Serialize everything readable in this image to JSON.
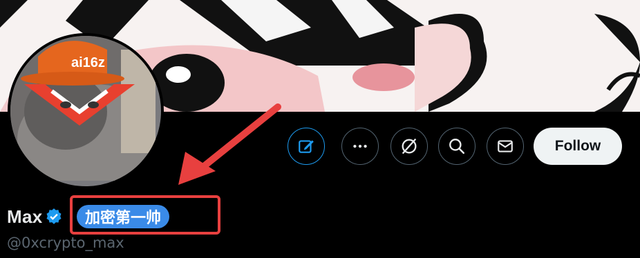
{
  "profile": {
    "display_name": "Max",
    "name_tag": "加密第一帅",
    "handle": "@0xcrypto_max",
    "verified": true
  },
  "avatar": {
    "hat_text": "ai16z"
  },
  "actions": [
    {
      "name": "edit",
      "icon": "edit-icon"
    },
    {
      "name": "more",
      "icon": "more-icon"
    },
    {
      "name": "grok",
      "icon": "grok-icon"
    },
    {
      "name": "search",
      "icon": "search-icon"
    },
    {
      "name": "message",
      "icon": "mail-icon"
    }
  ],
  "follow_label": "Follow",
  "colors": {
    "accent": "#1d9bf0",
    "verified": "#1d9bf0",
    "annotation": "#e8403f",
    "pill": "#3a8be8"
  }
}
